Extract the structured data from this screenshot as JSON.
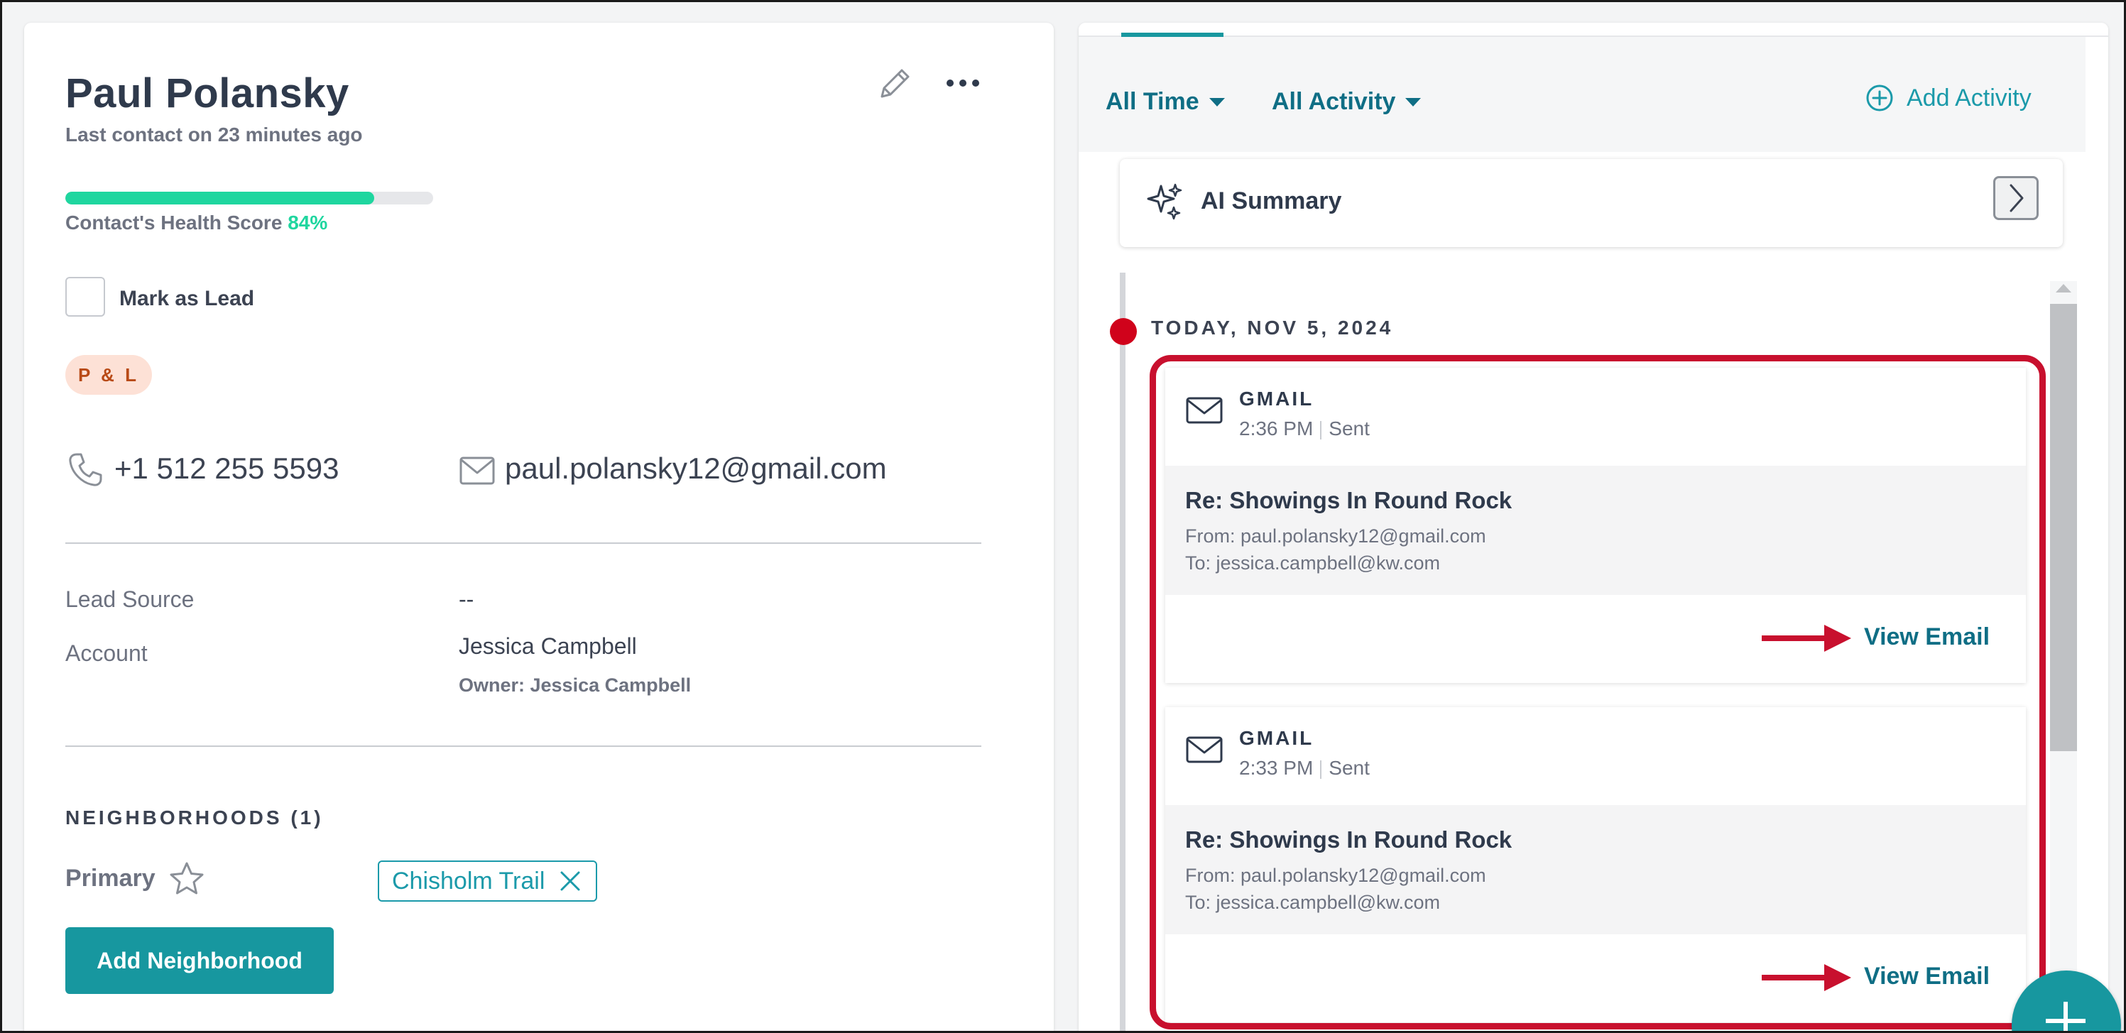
{
  "contact": {
    "name": "Paul Polansky",
    "last_contact": "Last contact on 23 minutes ago",
    "health_label": "Contact's Health Score",
    "health_value": "84%",
    "health_fraction": 0.84,
    "mark_as_lead_label": "Mark as Lead",
    "mark_as_lead_checked": false,
    "tag": "P & L",
    "phone": "+1 512 255 5593",
    "email": "paul.polansky12@gmail.com",
    "lead_source_label": "Lead Source",
    "lead_source_value": "--",
    "account_label": "Account",
    "account_value": "Jessica Campbell",
    "owner_text": "Owner: Jessica Campbell",
    "neighborhoods_heading": "NEIGHBORHOODS (1)",
    "primary_label": "Primary",
    "neighborhood_chip": "Chisholm Trail",
    "add_neighborhood_label": "Add Neighborhood"
  },
  "activity": {
    "filter_time": "All Time",
    "filter_activity": "All Activity",
    "add_activity_label": "Add Activity",
    "ai_summary_label": "AI Summary",
    "date_heading": "TODAY, NOV 5, 2024",
    "emails": [
      {
        "source": "GMAIL",
        "time": "2:36 PM",
        "status": "Sent",
        "subject": "Re: Showings In Round Rock",
        "from": "From: paul.polansky12@gmail.com",
        "to": "To: jessica.campbell@kw.com",
        "view_label": "View Email"
      },
      {
        "source": "GMAIL",
        "time": "2:33 PM",
        "status": "Sent",
        "subject": "Re: Showings In Round Rock",
        "from": "From: paul.polansky12@gmail.com",
        "to": "To: jessica.campbell@kw.com",
        "view_label": "View Email"
      }
    ]
  },
  "colors": {
    "accent": "#17979f",
    "link": "#0f6e85",
    "health": "#1fd69f",
    "highlight": "#c8102e",
    "timeline_dot": "#d0021b",
    "tag_bg": "#fde1d6",
    "tag_text": "#b84a16"
  },
  "icons": {
    "edit": "pencil-icon",
    "more": "more-dots-icon",
    "phone": "phone-icon",
    "email": "envelope-icon",
    "star": "star-icon",
    "remove": "close-icon",
    "add": "plus-circle-icon",
    "ai": "sparkle-icon",
    "expand": "chevron-right-icon"
  }
}
